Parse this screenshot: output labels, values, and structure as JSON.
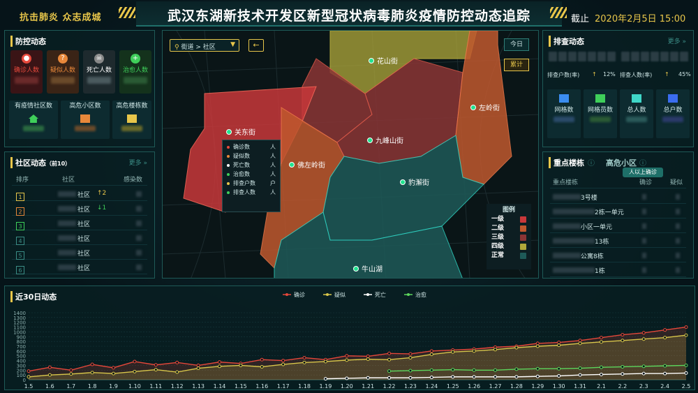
{
  "header": {
    "slogan": "抗击肺炎 众志成城",
    "title": "武汉东湖新技术开发区新型冠状病毒肺炎疫情防控动态追踪",
    "deadline_label": "截止",
    "deadline_value": "2020年2月5日 15:00"
  },
  "prevention": {
    "title": "防控动态",
    "stats": [
      {
        "label": "确诊人数",
        "icon": "virus-icon",
        "color": "#e64a3d"
      },
      {
        "label": "疑似人数",
        "icon": "question-icon",
        "color": "#e8883a"
      },
      {
        "label": "死亡人数",
        "icon": "skull-icon",
        "color": "#ffffff"
      },
      {
        "label": "治愈人数",
        "icon": "plus-icon",
        "color": "#3fcf5a"
      }
    ],
    "subs": [
      {
        "label": "有疫情社区数",
        "icon": "house-icon"
      },
      {
        "label": "高危小区数",
        "icon": "building-icon"
      },
      {
        "label": "高危楼栋数",
        "icon": "tower-icon"
      }
    ]
  },
  "community": {
    "title": "社区动态",
    "subtitle": "（前10）",
    "more": "更多 »",
    "headers": [
      "排序",
      "社区",
      "感染数"
    ],
    "rows": [
      {
        "rank": "1",
        "name": "社区",
        "trend": "↑2",
        "trend_color": "#e8c64a",
        "rank_color": "#e8c64a"
      },
      {
        "rank": "2",
        "name": "社区",
        "trend": "↓1",
        "trend_color": "#3fcf5a",
        "rank_color": "#e8883a"
      },
      {
        "rank": "3",
        "name": "社区",
        "trend": "",
        "trend_color": "#3fcf5a",
        "rank_color": "#3fcf5a"
      },
      {
        "rank": "4",
        "name": "社区",
        "trend": "",
        "trend_color": "#3b8d86",
        "rank_color": "#3b8d86"
      },
      {
        "rank": "5",
        "name": "社区",
        "trend": "",
        "trend_color": "#3b8d86",
        "rank_color": "#3b8d86"
      },
      {
        "rank": "6",
        "name": "社区",
        "trend": "",
        "trend_color": "#3b8d86",
        "rank_color": "#3b8d86"
      }
    ]
  },
  "map": {
    "street_sel": "街道 > 社区",
    "today_btn": "今日",
    "total_btn": "累计",
    "places": [
      "花山街",
      "左岭街",
      "关东街",
      "九峰山街",
      "佛左岭街",
      "豹澥街",
      "牛山湖"
    ],
    "tooltip": [
      "确诊数",
      "疑似数",
      "死亡数",
      "治愈数",
      "排查户数",
      "排查人数"
    ],
    "tooltip_unit": "人",
    "tooltip_unit2": "户",
    "legend_title": "图例",
    "legend": [
      {
        "label": "一级",
        "color": "#c8383a"
      },
      {
        "label": "二级",
        "color": "#c0582e"
      },
      {
        "label": "三级",
        "color": "#8a3535"
      },
      {
        "label": "四级",
        "color": "#b0a83a"
      },
      {
        "label": "正常",
        "color": "#1e5a58"
      }
    ]
  },
  "screening": {
    "title": "排查动态",
    "more": "更多 »",
    "rate1_label": "排查户数(率)",
    "rate1": "12%",
    "rate2_label": "排查人数(率)",
    "rate2": "45%",
    "cards": [
      {
        "label": "网格数",
        "icon": "grid-icon"
      },
      {
        "label": "网格员数",
        "icon": "person-icon"
      },
      {
        "label": "总人数",
        "icon": "people-icon"
      },
      {
        "label": "总户数",
        "icon": "household-icon"
      }
    ]
  },
  "key": {
    "tab1": "重点楼栋",
    "tab2": "高危小区",
    "tip": "人以上确诊",
    "headers": [
      "重点楼栋",
      "确诊",
      "疑似"
    ],
    "rows": [
      "3号楼",
      "2栋一单元",
      "小区一单元",
      "13栋",
      "公寓8栋",
      "1栋"
    ]
  },
  "trend": {
    "title": "近30日动态",
    "legend": [
      "确诊",
      "疑似",
      "死亡",
      "治愈"
    ]
  },
  "chart_data": {
    "type": "line",
    "title": "近30日动态",
    "categories": [
      "1.5",
      "1.6",
      "1.7",
      "1.8",
      "1.9",
      "1.10",
      "1.11",
      "1.12",
      "1.13",
      "1.14",
      "1.15",
      "1.16",
      "1.17",
      "1.18",
      "1.19",
      "1.20",
      "1.21",
      "1.22",
      "1.23",
      "1.24",
      "1.25",
      "1.26",
      "1.27",
      "1.28",
      "1.29",
      "1.30",
      "1.31",
      "2.1",
      "2.2",
      "2.3",
      "2.4",
      "2.5"
    ],
    "ylim": [
      0,
      1400
    ],
    "yticks": [
      0,
      100,
      200,
      300,
      400,
      500,
      600,
      700,
      800,
      900,
      1000,
      1100,
      1200,
      1300,
      1400
    ],
    "series": [
      {
        "name": "确诊",
        "color": "#e5473a",
        "values": [
          180,
          260,
          200,
          320,
          250,
          380,
          310,
          360,
          300,
          370,
          340,
          420,
          400,
          460,
          420,
          500,
          490,
          550,
          540,
          600,
          620,
          640,
          680,
          700,
          760,
          780,
          820,
          880,
          940,
          980,
          1040,
          1100
        ]
      },
      {
        "name": "疑似",
        "color": "#d8c64a",
        "values": [
          60,
          100,
          120,
          150,
          130,
          170,
          210,
          160,
          240,
          280,
          300,
          270,
          320,
          360,
          380,
          410,
          430,
          420,
          460,
          530,
          580,
          600,
          630,
          670,
          700,
          720,
          760,
          790,
          820,
          850,
          880,
          930
        ]
      },
      {
        "name": "死亡",
        "color": "#ffffff",
        "values": [
          null,
          null,
          null,
          null,
          null,
          null,
          null,
          null,
          null,
          null,
          null,
          null,
          null,
          null,
          20,
          30,
          40,
          40,
          40,
          50,
          60,
          60,
          60,
          60,
          70,
          80,
          100,
          110,
          120,
          130,
          130,
          140
        ]
      },
      {
        "name": "治愈",
        "color": "#5cd65c",
        "values": [
          null,
          null,
          null,
          null,
          null,
          null,
          null,
          null,
          null,
          null,
          null,
          null,
          null,
          null,
          null,
          null,
          null,
          180,
          190,
          200,
          210,
          200,
          200,
          220,
          230,
          230,
          240,
          260,
          270,
          280,
          290,
          300
        ]
      }
    ]
  }
}
